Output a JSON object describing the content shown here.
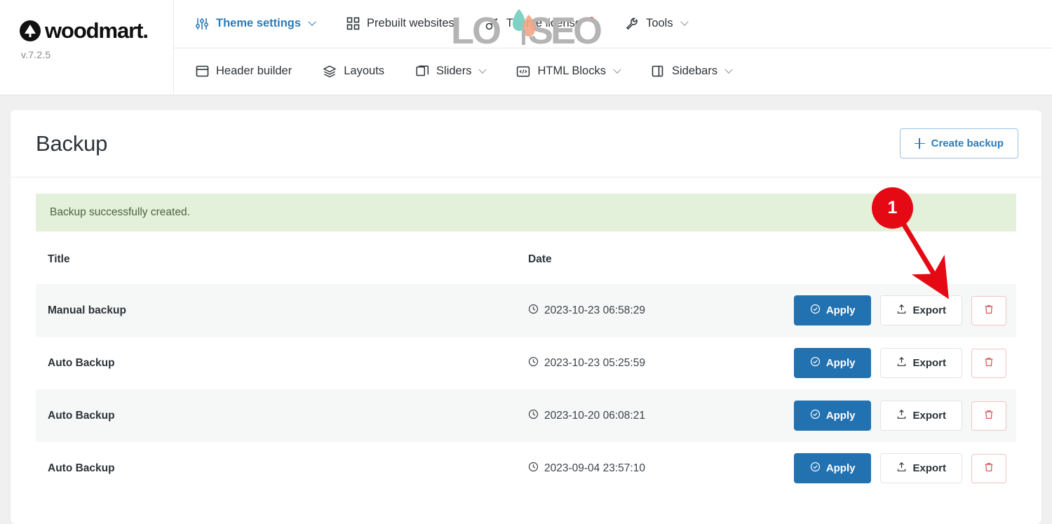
{
  "brand": {
    "logo_icon": "woodmart-tree-mark-icon",
    "name": "woodmart.",
    "version": "v.7.2.5"
  },
  "watermark": {
    "text": "LOYSEO",
    "colors": {
      "gray": "#b3b3b3",
      "teal": "#7fd1c4",
      "coral": "#f3a585"
    }
  },
  "nav": {
    "row1": [
      {
        "label": "Theme settings",
        "icon": "sliders-icon",
        "caret": true,
        "active": true,
        "dot": false
      },
      {
        "label": "Prebuilt websites",
        "icon": "grid-squares-icon",
        "caret": false,
        "active": false,
        "dot": false
      },
      {
        "label": "Theme license",
        "icon": "key-icon",
        "caret": false,
        "active": false,
        "dot": true
      },
      {
        "label": "Tools",
        "icon": "wrench-icon",
        "caret": true,
        "active": false,
        "dot": false
      }
    ],
    "row2": [
      {
        "label": "Header builder",
        "icon": "header-layout-icon",
        "caret": false
      },
      {
        "label": "Layouts",
        "icon": "layers-icon",
        "caret": false
      },
      {
        "label": "Sliders",
        "icon": "slides-stack-icon",
        "caret": true
      },
      {
        "label": "HTML Blocks",
        "icon": "code-block-icon",
        "caret": true
      },
      {
        "label": "Sidebars",
        "icon": "sidebar-panel-icon",
        "caret": true
      }
    ]
  },
  "page": {
    "title": "Backup",
    "create_button": {
      "label": "Create backup",
      "icon": "plus-icon"
    },
    "notice": "Backup successfully created."
  },
  "table": {
    "columns": [
      "Title",
      "Date"
    ],
    "rows": [
      {
        "title": "Manual backup",
        "date": "2023-10-23 06:58:29",
        "date_icon": "clock-icon",
        "apply": "Apply",
        "export": "Export",
        "delete_icon": "trash-icon"
      },
      {
        "title": "Auto Backup",
        "date": "2023-10-23 05:25:59",
        "date_icon": "clock-icon",
        "apply": "Apply",
        "export": "Export",
        "delete_icon": "trash-icon"
      },
      {
        "title": "Auto Backup",
        "date": "2023-10-20 06:08:21",
        "date_icon": "clock-icon",
        "apply": "Apply",
        "export": "Export",
        "delete_icon": "trash-icon"
      },
      {
        "title": "Auto Backup",
        "date": "2023-09-04 23:57:10",
        "date_icon": "clock-icon",
        "apply": "Apply",
        "export": "Export",
        "delete_icon": "trash-icon"
      }
    ]
  },
  "annotation": {
    "step_number": "1",
    "color": "#e50914",
    "points_to": "export-button-row-1"
  },
  "colors": {
    "accent_blue": "#2271b1",
    "link_blue": "#2e7bb8",
    "notice_green_bg": "#e3f0da",
    "notice_green_text": "#4d6343",
    "danger_red": "#d9575a",
    "page_bg": "#f0f0f1",
    "row_alt_bg": "#f6f7f7"
  }
}
